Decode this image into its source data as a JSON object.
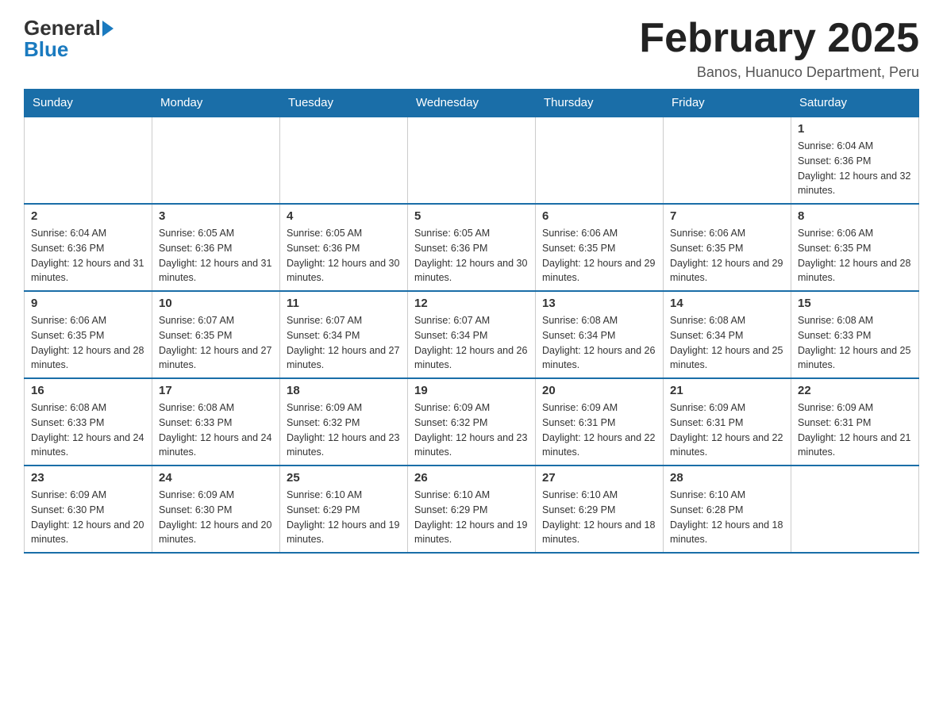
{
  "logo": {
    "general": "General",
    "blue": "Blue",
    "arrow": "▶"
  },
  "title": "February 2025",
  "subtitle": "Banos, Huanuco Department, Peru",
  "days_header": [
    "Sunday",
    "Monday",
    "Tuesday",
    "Wednesday",
    "Thursday",
    "Friday",
    "Saturday"
  ],
  "weeks": [
    [
      {
        "day": "",
        "info": ""
      },
      {
        "day": "",
        "info": ""
      },
      {
        "day": "",
        "info": ""
      },
      {
        "day": "",
        "info": ""
      },
      {
        "day": "",
        "info": ""
      },
      {
        "day": "",
        "info": ""
      },
      {
        "day": "1",
        "info": "Sunrise: 6:04 AM\nSunset: 6:36 PM\nDaylight: 12 hours and 32 minutes."
      }
    ],
    [
      {
        "day": "2",
        "info": "Sunrise: 6:04 AM\nSunset: 6:36 PM\nDaylight: 12 hours and 31 minutes."
      },
      {
        "day": "3",
        "info": "Sunrise: 6:05 AM\nSunset: 6:36 PM\nDaylight: 12 hours and 31 minutes."
      },
      {
        "day": "4",
        "info": "Sunrise: 6:05 AM\nSunset: 6:36 PM\nDaylight: 12 hours and 30 minutes."
      },
      {
        "day": "5",
        "info": "Sunrise: 6:05 AM\nSunset: 6:36 PM\nDaylight: 12 hours and 30 minutes."
      },
      {
        "day": "6",
        "info": "Sunrise: 6:06 AM\nSunset: 6:35 PM\nDaylight: 12 hours and 29 minutes."
      },
      {
        "day": "7",
        "info": "Sunrise: 6:06 AM\nSunset: 6:35 PM\nDaylight: 12 hours and 29 minutes."
      },
      {
        "day": "8",
        "info": "Sunrise: 6:06 AM\nSunset: 6:35 PM\nDaylight: 12 hours and 28 minutes."
      }
    ],
    [
      {
        "day": "9",
        "info": "Sunrise: 6:06 AM\nSunset: 6:35 PM\nDaylight: 12 hours and 28 minutes."
      },
      {
        "day": "10",
        "info": "Sunrise: 6:07 AM\nSunset: 6:35 PM\nDaylight: 12 hours and 27 minutes."
      },
      {
        "day": "11",
        "info": "Sunrise: 6:07 AM\nSunset: 6:34 PM\nDaylight: 12 hours and 27 minutes."
      },
      {
        "day": "12",
        "info": "Sunrise: 6:07 AM\nSunset: 6:34 PM\nDaylight: 12 hours and 26 minutes."
      },
      {
        "day": "13",
        "info": "Sunrise: 6:08 AM\nSunset: 6:34 PM\nDaylight: 12 hours and 26 minutes."
      },
      {
        "day": "14",
        "info": "Sunrise: 6:08 AM\nSunset: 6:34 PM\nDaylight: 12 hours and 25 minutes."
      },
      {
        "day": "15",
        "info": "Sunrise: 6:08 AM\nSunset: 6:33 PM\nDaylight: 12 hours and 25 minutes."
      }
    ],
    [
      {
        "day": "16",
        "info": "Sunrise: 6:08 AM\nSunset: 6:33 PM\nDaylight: 12 hours and 24 minutes."
      },
      {
        "day": "17",
        "info": "Sunrise: 6:08 AM\nSunset: 6:33 PM\nDaylight: 12 hours and 24 minutes."
      },
      {
        "day": "18",
        "info": "Sunrise: 6:09 AM\nSunset: 6:32 PM\nDaylight: 12 hours and 23 minutes."
      },
      {
        "day": "19",
        "info": "Sunrise: 6:09 AM\nSunset: 6:32 PM\nDaylight: 12 hours and 23 minutes."
      },
      {
        "day": "20",
        "info": "Sunrise: 6:09 AM\nSunset: 6:31 PM\nDaylight: 12 hours and 22 minutes."
      },
      {
        "day": "21",
        "info": "Sunrise: 6:09 AM\nSunset: 6:31 PM\nDaylight: 12 hours and 22 minutes."
      },
      {
        "day": "22",
        "info": "Sunrise: 6:09 AM\nSunset: 6:31 PM\nDaylight: 12 hours and 21 minutes."
      }
    ],
    [
      {
        "day": "23",
        "info": "Sunrise: 6:09 AM\nSunset: 6:30 PM\nDaylight: 12 hours and 20 minutes."
      },
      {
        "day": "24",
        "info": "Sunrise: 6:09 AM\nSunset: 6:30 PM\nDaylight: 12 hours and 20 minutes."
      },
      {
        "day": "25",
        "info": "Sunrise: 6:10 AM\nSunset: 6:29 PM\nDaylight: 12 hours and 19 minutes."
      },
      {
        "day": "26",
        "info": "Sunrise: 6:10 AM\nSunset: 6:29 PM\nDaylight: 12 hours and 19 minutes."
      },
      {
        "day": "27",
        "info": "Sunrise: 6:10 AM\nSunset: 6:29 PM\nDaylight: 12 hours and 18 minutes."
      },
      {
        "day": "28",
        "info": "Sunrise: 6:10 AM\nSunset: 6:28 PM\nDaylight: 12 hours and 18 minutes."
      },
      {
        "day": "",
        "info": ""
      }
    ]
  ]
}
